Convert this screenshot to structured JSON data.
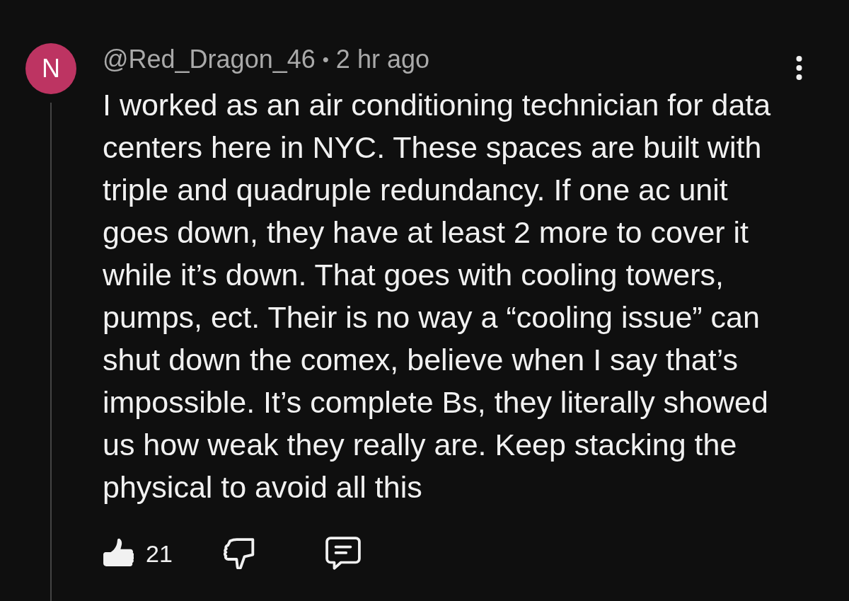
{
  "comment": {
    "avatar": {
      "initial": "N"
    },
    "author": "@Red_Dragon_46",
    "separator": "•",
    "time": "2 hr ago",
    "body": "I worked as an air conditioning technician for data centers here in NYC. These spaces are built with triple and quadruple redundancy. If one ac unit goes down, they have at least 2 more to cover it while it’s down. That goes with cooling towers, pumps, ect. Their is no way a “cooling issue” can shut down the comex, believe when I say that’s impossible. It’s complete Bs, they literally showed us how weak they really are. Keep stacking the physical to avoid all this",
    "likes": "21"
  }
}
